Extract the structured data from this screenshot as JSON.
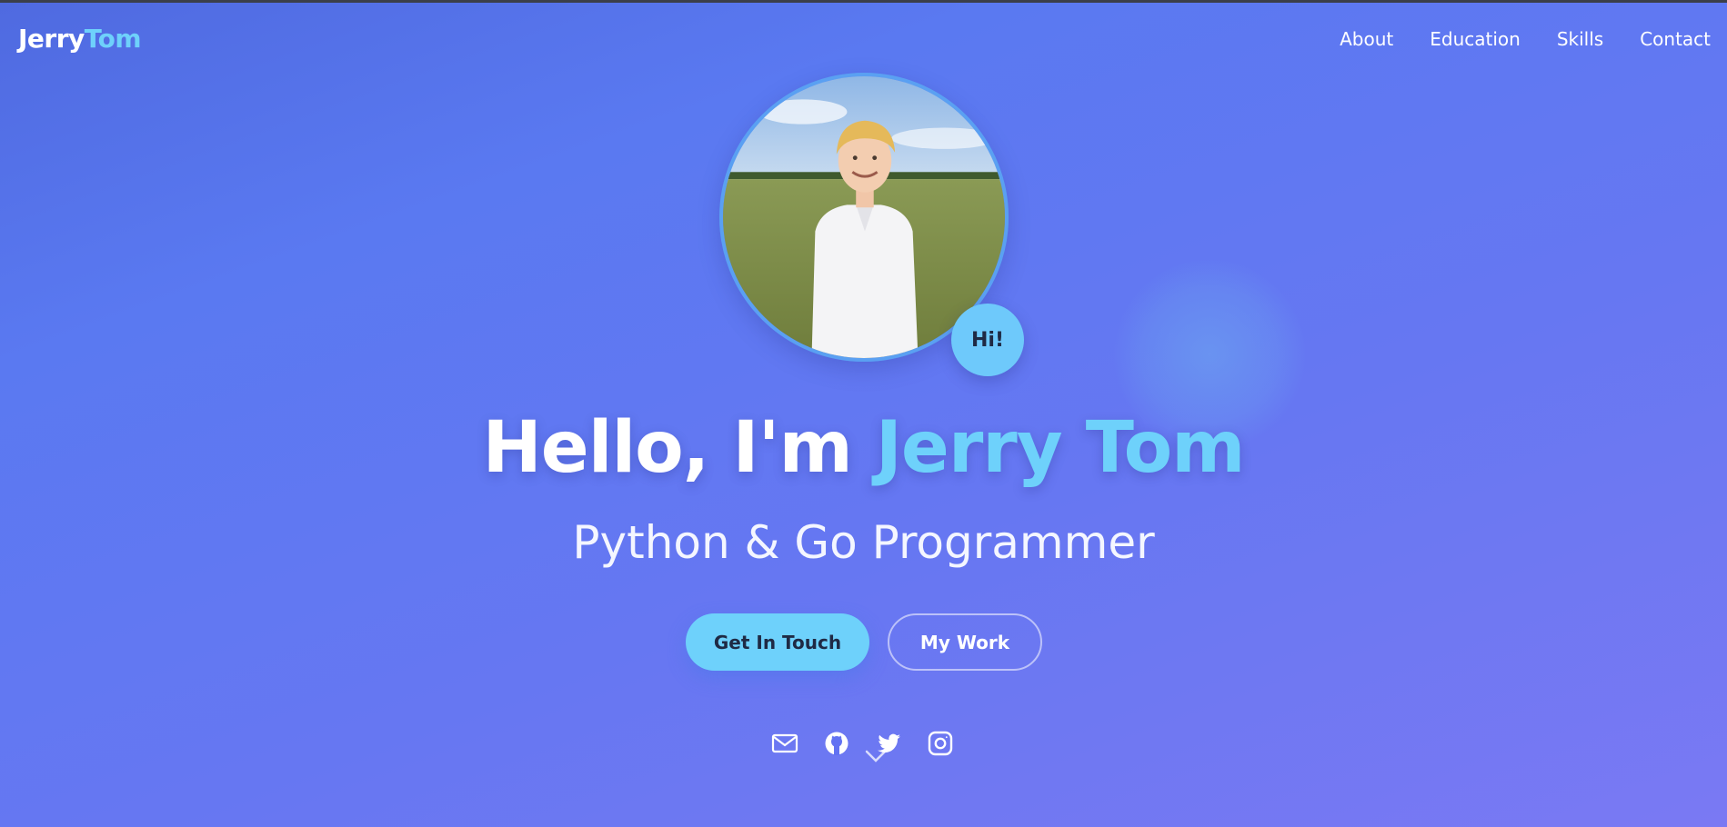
{
  "brand": {
    "first": "Jerry",
    "second": "Tom",
    "accent_color": "#6ed1fb"
  },
  "nav": {
    "items": [
      {
        "label": "About"
      },
      {
        "label": "Education"
      },
      {
        "label": "Skills"
      },
      {
        "label": "Contact"
      }
    ]
  },
  "hero": {
    "avatar_alt": "Profile photo of a smiling young man in a white shirt standing in a grassy field",
    "badge": "Hi!",
    "greeting": "Hello, I'm",
    "name": "Jerry Tom",
    "subtitle": "Python & Go Programmer"
  },
  "buttons": {
    "primary": "Get In Touch",
    "secondary": "My Work"
  },
  "social": {
    "icons": [
      "email-icon",
      "github-icon",
      "twitter-icon",
      "instagram-icon"
    ]
  },
  "colors": {
    "background_start": "#4f6ae0",
    "background_end": "#7a79f3",
    "badge": "#6ec9fb",
    "button_primary": "#6ed1fb"
  }
}
